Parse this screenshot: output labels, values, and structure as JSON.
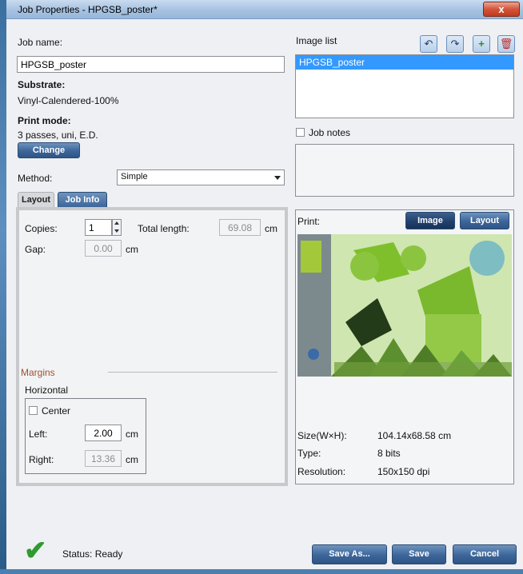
{
  "window": {
    "title": "Job Properties - HPGSB_poster*",
    "close_symbol": "x"
  },
  "job": {
    "name_label": "Job name:",
    "name_value": "HPGSB_poster"
  },
  "substrate": {
    "label": "Substrate:",
    "value": "Vinyl-Calendered-100%"
  },
  "print_mode": {
    "label": "Print mode:",
    "value": "3 passes, uni, E.D.",
    "change_button": "Change"
  },
  "method": {
    "label": "Method:",
    "selected": "Simple"
  },
  "tabs": [
    {
      "label": "Layout",
      "active": true
    },
    {
      "label": "Job Info",
      "active": false
    }
  ],
  "layout": {
    "copies_label": "Copies:",
    "copies_value": "1",
    "total_length_label": "Total length:",
    "total_length_value": "69.08",
    "total_length_unit": "cm",
    "gap_label": "Gap:",
    "gap_value": "0.00",
    "gap_unit": "cm"
  },
  "margins": {
    "title": "Margins",
    "horizontal_label": "Horizontal",
    "center_label": "Center",
    "left_label": "Left:",
    "left_value": "2.00",
    "left_unit": "cm",
    "right_label": "Right:",
    "right_value": "13.36",
    "right_unit": "cm"
  },
  "image_list": {
    "label": "Image list",
    "items": [
      "HPGSB_poster"
    ],
    "toolbar_icons": [
      "undo-icon",
      "redo-icon",
      "add-image-icon",
      "delete-icon"
    ]
  },
  "job_notes": {
    "label": "Job notes",
    "text": ""
  },
  "print_preview": {
    "label": "Print:",
    "image_button": "Image",
    "layout_button": "Layout",
    "size_label": "Size(W×H):",
    "size_value": "104.14x68.58 cm",
    "type_label": "Type:",
    "type_value": "8 bits",
    "resolution_label": "Resolution:",
    "resolution_value": "150x150 dpi"
  },
  "status": {
    "text": "Status: Ready",
    "icon": "checkmark-icon",
    "color": "#2f9a2f"
  },
  "footer": {
    "save_as": "Save As...",
    "save": "Save",
    "cancel": "Cancel"
  },
  "colors": {
    "accent": "#3c659a",
    "selection": "#3399ff",
    "margins_title": "#a0522d"
  }
}
